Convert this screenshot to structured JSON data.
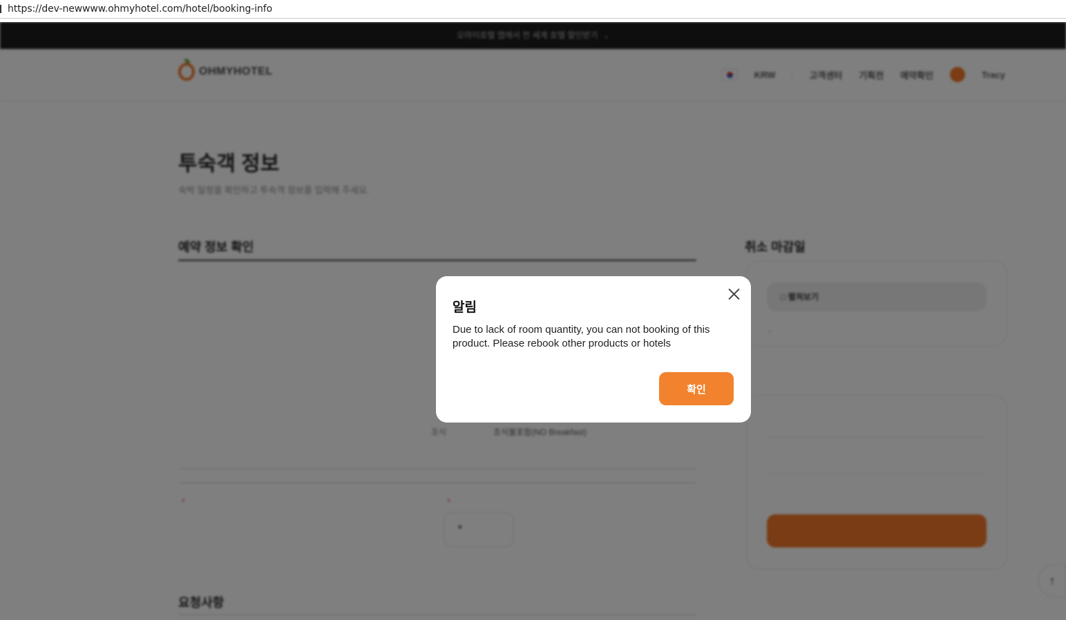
{
  "browser": {
    "url": "https://dev-newwww.ohmyhotel.com/hotel/booking-info"
  },
  "promo": {
    "text": "오마이호텔 앱에서 전 세계 호텔 할인받기"
  },
  "header": {
    "logo": "OHMYHOTEL",
    "currency": "KRW",
    "nav": [
      "고객센터",
      "기획전",
      "예약확인"
    ],
    "user": "Tracy"
  },
  "page": {
    "title": "투숙객 정보",
    "subtitle": "숙박 일정을 확인하고 투숙객 정보를 입력해 주세요.",
    "booking_section": "예약 정보 확인",
    "breakfast_label": "조식",
    "breakfast_value": "조식불포함(NO Breakfast)",
    "request_section": "요청사항",
    "required_mark": "*"
  },
  "sidebar": {
    "cancel_title": "취소 마감일",
    "expand_button": "펼쳐보기",
    "dash": "-"
  },
  "modal": {
    "title": "알림",
    "message": "Due to lack of room quantity, you can not booking of this product. Please rebook other products or hotels",
    "confirm": "확인"
  },
  "colors": {
    "accent": "#f2822d",
    "overlay": "rgba(0,0,0,0.5)"
  }
}
